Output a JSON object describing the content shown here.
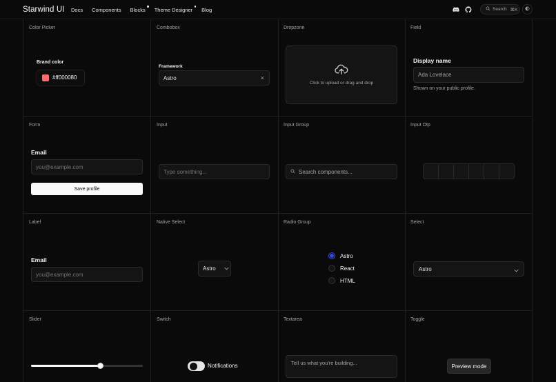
{
  "nav": {
    "brand": "Starwind UI",
    "links": [
      {
        "label": "Docs",
        "dot": false
      },
      {
        "label": "Components",
        "dot": false
      },
      {
        "label": "Blocks",
        "dot": true
      },
      {
        "label": "Theme Designer",
        "dot": true
      },
      {
        "label": "Blog",
        "dot": false
      }
    ],
    "icons": [
      "discord-icon",
      "github-icon"
    ],
    "search": {
      "label": "Search",
      "shortcut": "⌘K"
    },
    "theme_icon": "moon-icon"
  },
  "cells": {
    "color_picker": {
      "title": "Color Picker",
      "label": "Brand color",
      "value": "#ff000080",
      "swatch_color": "#ff6b6b"
    },
    "combobox": {
      "title": "Combobox",
      "label": "Framework",
      "value": "Astro"
    },
    "dropzone": {
      "title": "Dropzone",
      "text": "Click to upload or drag and drop",
      "icon": "upload-cloud-icon"
    },
    "field": {
      "title": "Field",
      "label": "Display name",
      "value": "Ada Lovelace",
      "help": "Shown on your public profile."
    },
    "form": {
      "title": "Form",
      "label": "Email",
      "placeholder": "you@example.com",
      "button": "Save profile"
    },
    "input": {
      "title": "Input",
      "placeholder": "Type something..."
    },
    "input_group": {
      "title": "Input Group",
      "placeholder": "Search components..."
    },
    "input_otp": {
      "title": "Input Otp",
      "slots": 6
    },
    "label": {
      "title": "Label",
      "label": "Email",
      "placeholder": "you@example.com"
    },
    "native_select": {
      "title": "Native Select",
      "value": "Astro"
    },
    "radio_group": {
      "title": "Radio Group",
      "options": [
        "Astro",
        "React",
        "HTML"
      ],
      "selected": "Astro",
      "accent": "#2f46e0"
    },
    "select": {
      "title": "Select",
      "value": "Astro"
    },
    "slider": {
      "title": "Slider",
      "value_percent": 62
    },
    "switch": {
      "title": "Switch",
      "label": "Notifications",
      "on": true
    },
    "textarea": {
      "title": "Textarea",
      "placeholder": "Tell us what you're building..."
    },
    "toggle": {
      "title": "Toggle",
      "label": "Preview mode"
    }
  }
}
